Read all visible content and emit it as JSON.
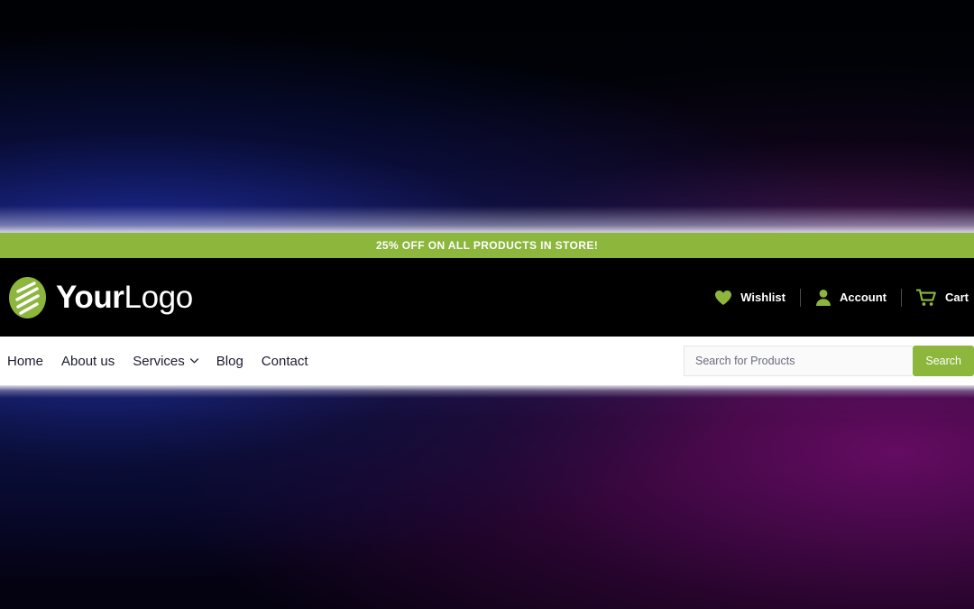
{
  "colors": {
    "brand_green": "#8cb63c",
    "header_bg": "#000000",
    "nav_bg": "#ffffff",
    "nav_text": "#1c1c30",
    "promo_text": "#ffffff",
    "divider": "#4c4c4c"
  },
  "promo": {
    "text": "25% OFF ON ALL PRODUCTS IN STORE!"
  },
  "header": {
    "logo": {
      "icon_name": "leaf-logo-icon",
      "text_bold": "Your",
      "text_light": "Logo"
    },
    "actions": [
      {
        "icon_name": "heart-icon",
        "label": "Wishlist"
      },
      {
        "icon_name": "user-icon",
        "label": "Account"
      },
      {
        "icon_name": "cart-icon",
        "label": "Cart"
      }
    ]
  },
  "nav": {
    "items": [
      {
        "label": "Home",
        "has_dropdown": false
      },
      {
        "label": "About us",
        "has_dropdown": false
      },
      {
        "label": "Services",
        "has_dropdown": true
      },
      {
        "label": "Blog",
        "has_dropdown": false
      },
      {
        "label": "Contact",
        "has_dropdown": false
      }
    ],
    "search": {
      "placeholder": "Search for Products",
      "value": "",
      "button_label": "Search"
    }
  }
}
